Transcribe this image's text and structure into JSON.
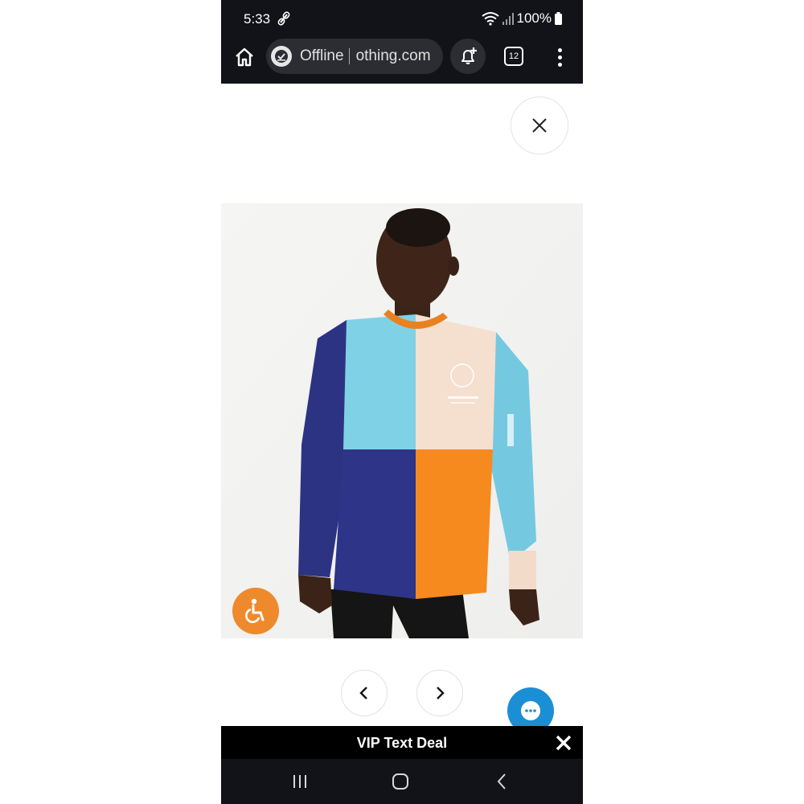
{
  "status_bar": {
    "time": "5:33",
    "battery": "100%"
  },
  "browser": {
    "offline_label": "Offline",
    "url_fragment": "othing.com",
    "tab_count": "12"
  },
  "banner": {
    "text": "VIP Text Deal"
  },
  "colors": {
    "accent_orange": "#ee8a2c",
    "chat_blue": "#1a8fd6",
    "system_bar": "#111318"
  },
  "icons": {
    "home": "home-icon",
    "offline": "offline-check-icon",
    "notification": "bell-add-icon",
    "tabs": "tab-switcher-icon",
    "menu": "kebab-menu-icon",
    "close": "close-icon",
    "accessibility": "wheelchair-icon",
    "prev": "chevron-left-icon",
    "next": "chevron-right-icon",
    "chat": "chat-bubble-icon"
  }
}
